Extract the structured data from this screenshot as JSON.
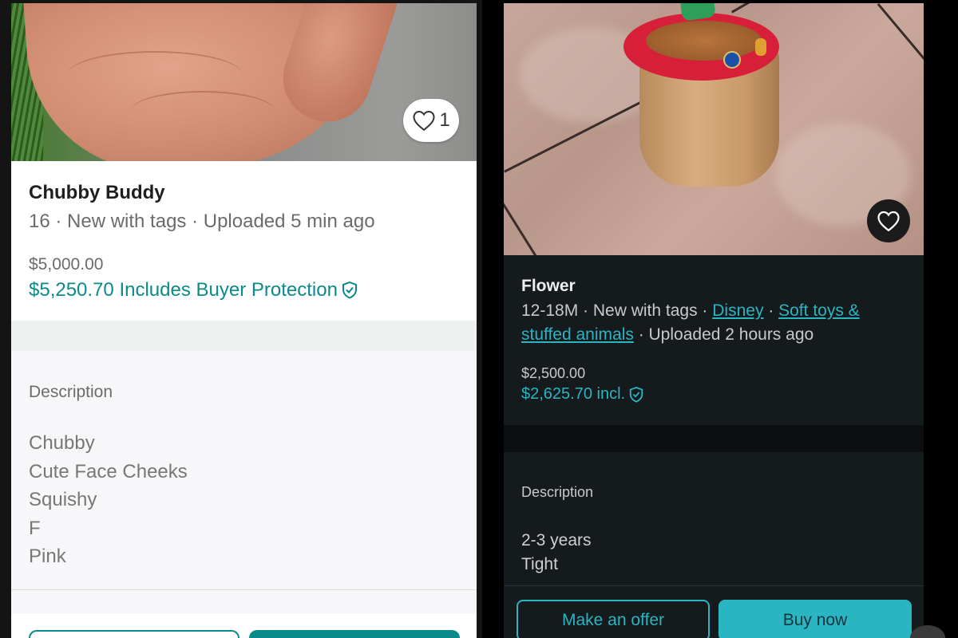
{
  "left_listing": {
    "title": "Chubby Buddy",
    "meta": "16 · New with tags · Uploaded 5 min ago",
    "price": "$5,000.00",
    "total_price": "$5,250.70 Includes Buyer Protection",
    "like_count": "1",
    "description_label": "Description",
    "description_lines": [
      "Chubby",
      "Cute Face Cheeks",
      "Squishy",
      "F",
      "Pink"
    ]
  },
  "right_listing": {
    "title": "Flower",
    "meta_prefix": "12-18M · New with tags · ",
    "brand_link": "Disney",
    "meta_sep": " · ",
    "category_link": "Soft toys & stuffed animals",
    "meta_suffix": " · Uploaded 2 hours ago",
    "price": "$2,500.00",
    "total_price": "$2,625.70 incl.",
    "description_label": "Description",
    "description_lines": [
      "2-3 years",
      "Tight"
    ],
    "offer_button": "Make an offer",
    "buy_button": "Buy now"
  },
  "colors": {
    "accent_light": "#0b8a8a",
    "accent_dark": "#29b5c2",
    "dark_card": "#151a1d"
  },
  "icons": {
    "like": "heart-outline-icon",
    "protection": "shield-check-icon"
  }
}
